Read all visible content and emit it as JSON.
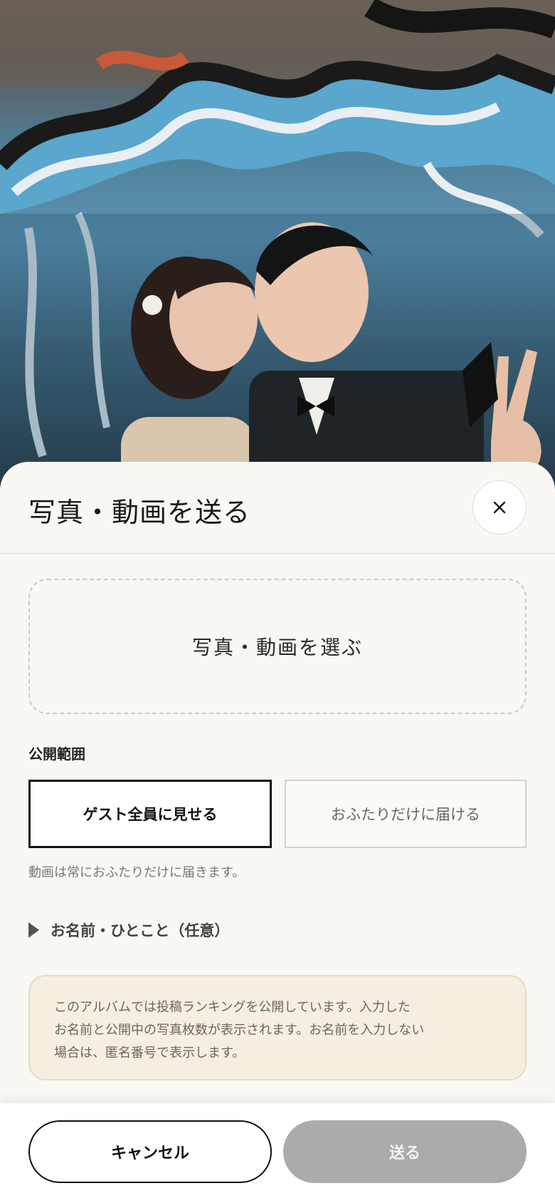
{
  "sheet": {
    "title": "写真・動画を送る",
    "close_icon": "close-icon",
    "select_media_label": "写真・動画を選ぶ",
    "visibility": {
      "label": "公開範囲",
      "options": [
        "ゲスト全員に見せる",
        "おふたりだけに届ける"
      ],
      "selected": "ゲスト全員に見せる",
      "note": "動画は常におふたりだけに届きます。"
    },
    "name_toggle": {
      "icon": "disclosure-triangle-icon",
      "label": "お名前・ひとこと（任意）"
    },
    "ranking_notice": {
      "lines": [
        "このアルバムでは投稿ランキングを公開しています。入力した",
        "お名前と公開中の写真枚数が表示されます。お名前を入力しない",
        "場合は、匿名番号で表示します。"
      ]
    }
  },
  "footer": {
    "cancel_label": "キャンセル",
    "send_label": "送る"
  },
  "colors": {
    "sheet_bg": "#f9f8f4",
    "selected_border": "#111111",
    "notice_bg": "#f5efe1",
    "send_disabled": "#ababab"
  }
}
